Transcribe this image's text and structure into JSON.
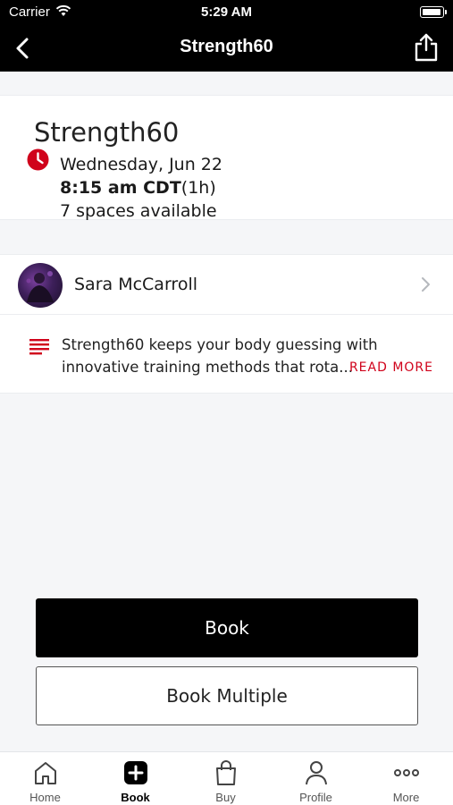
{
  "status_bar": {
    "carrier": "Carrier",
    "time": "5:29 AM"
  },
  "nav": {
    "title": "Strength60",
    "back_icon": "chevron-left-icon",
    "share_icon": "share-icon"
  },
  "class_info": {
    "name": "Strength60",
    "date": "Wednesday, Jun 22",
    "time": "8:15 am CDT",
    "duration": "(1h)",
    "spaces": "7 spaces available",
    "accent_color": "#d0021b"
  },
  "instructor": {
    "name": "Sara McCarroll"
  },
  "description": {
    "text": "Strength60 keeps your body guessing with innovative training methods that rota...",
    "read_more": "READ MORE"
  },
  "actions": {
    "book": "Book",
    "book_multiple": "Book Multiple"
  },
  "tabs": [
    {
      "label": "Home",
      "icon": "home-icon"
    },
    {
      "label": "Book",
      "icon": "plus-square-icon",
      "active": true
    },
    {
      "label": "Buy",
      "icon": "shopping-bag-icon"
    },
    {
      "label": "Profile",
      "icon": "person-icon"
    },
    {
      "label": "More",
      "icon": "more-dots-icon"
    }
  ]
}
